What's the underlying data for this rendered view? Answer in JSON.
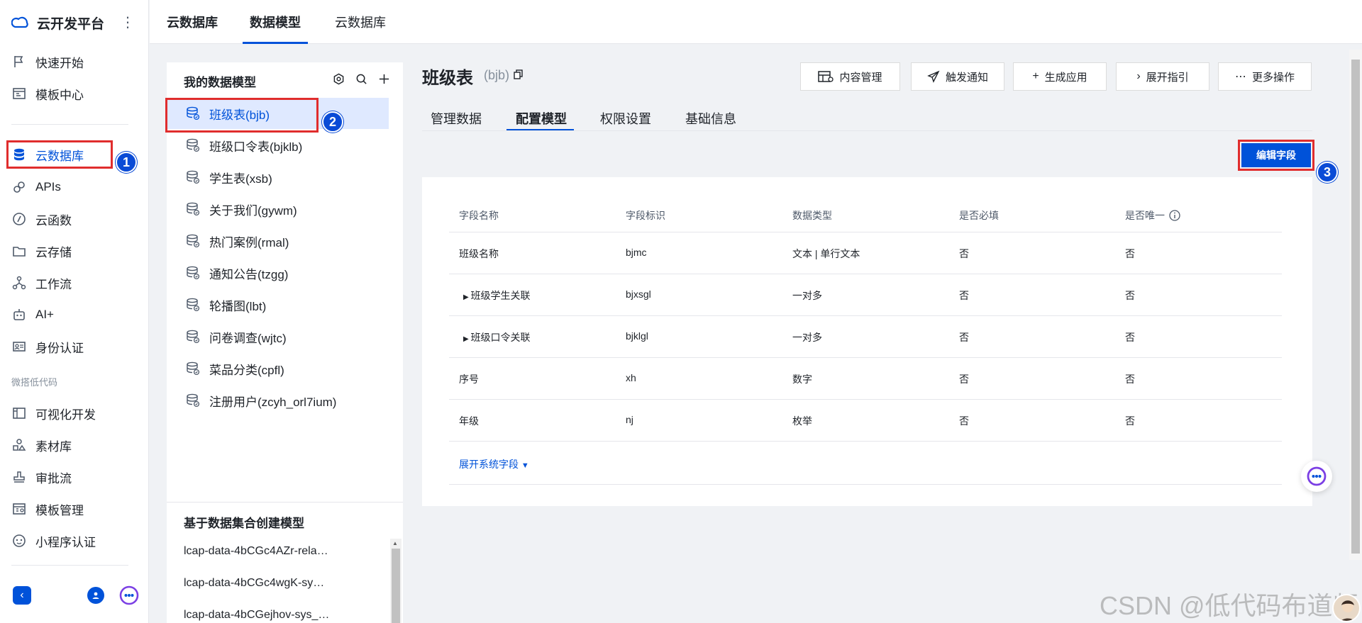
{
  "app": {
    "title": "云开发平台"
  },
  "sidebar": {
    "items": [
      {
        "label": "快速开始",
        "icon": "flag-icon"
      },
      {
        "label": "模板中心",
        "icon": "template-icon"
      },
      {
        "label": "云数据库",
        "icon": "database-icon",
        "active": true
      },
      {
        "label": "APIs",
        "icon": "link-icon"
      },
      {
        "label": "云函数",
        "icon": "function-icon"
      },
      {
        "label": "云存储",
        "icon": "folder-icon"
      },
      {
        "label": "工作流",
        "icon": "workflow-icon"
      },
      {
        "label": "AI+",
        "icon": "robot-icon"
      },
      {
        "label": "身份认证",
        "icon": "id-card-icon"
      }
    ],
    "section_label": "微搭低代码",
    "lowcode_items": [
      {
        "label": "可视化开发",
        "icon": "layout-icon"
      },
      {
        "label": "素材库",
        "icon": "shapes-icon"
      },
      {
        "label": "审批流",
        "icon": "stamp-icon"
      },
      {
        "label": "模板管理",
        "icon": "template-manage-icon"
      },
      {
        "label": "小程序认证",
        "icon": "miniprogram-icon"
      }
    ]
  },
  "topbar": {
    "tabs": [
      {
        "label": "云数据库"
      },
      {
        "label": "数据模型",
        "active": true
      },
      {
        "label": "云数据库"
      }
    ]
  },
  "model_panel": {
    "title": "我的数据模型",
    "models": [
      "班级表(bjb)",
      "班级口令表(bjklb)",
      "学生表(xsb)",
      "关于我们(gywm)",
      "热门案例(rmal)",
      "通知公告(tzgg)",
      "轮播图(lbt)",
      "问卷调查(wjtc)",
      "菜品分类(cpfl)",
      "注册用户(zcyh_orl7ium)"
    ],
    "selected_index": 0,
    "dataset_title": "基于数据集合创建模型",
    "datasets": [
      "lcap-data-4bCGc4AZr-rela…",
      "lcap-data-4bCGc4wgK-sy…",
      "lcap-data-4bCGejhov-sys_…"
    ]
  },
  "main": {
    "title": "班级表",
    "subtitle": "(bjb)",
    "actions": [
      {
        "label": "内容管理",
        "icon": "content-icon"
      },
      {
        "label": "触发通知",
        "icon": "send-icon"
      },
      {
        "label": "生成应用",
        "icon": "plus-icon"
      },
      {
        "label": "展开指引",
        "icon": "chevron-right-icon"
      },
      {
        "label": "更多操作",
        "icon": "more-icon"
      }
    ],
    "tabs": [
      {
        "label": "管理数据"
      },
      {
        "label": "配置模型",
        "active": true
      },
      {
        "label": "权限设置"
      },
      {
        "label": "基础信息"
      }
    ],
    "edit_button": "编辑字段",
    "table": {
      "headers": [
        "字段名称",
        "字段标识",
        "数据类型",
        "是否必填",
        "是否唯一"
      ],
      "rows": [
        {
          "name": "班级名称",
          "id": "bjmc",
          "type": "文本 | 单行文本",
          "required": "否",
          "unique": "否",
          "expandable": false
        },
        {
          "name": "班级学生关联",
          "id": "bjxsgl",
          "type": "一对多",
          "required": "否",
          "unique": "否",
          "expandable": true
        },
        {
          "name": "班级口令关联",
          "id": "bjklgl",
          "type": "一对多",
          "required": "否",
          "unique": "否",
          "expandable": true
        },
        {
          "name": "序号",
          "id": "xh",
          "type": "数字",
          "required": "否",
          "unique": "否",
          "expandable": false
        },
        {
          "name": "年级",
          "id": "nj",
          "type": "枚举",
          "required": "否",
          "unique": "否",
          "expandable": false
        }
      ]
    },
    "expand_system_fields": "展开系统字段"
  },
  "annotations": {
    "step1": "1",
    "step2": "2",
    "step3": "3"
  },
  "watermark": "CSDN @低代码布道师",
  "colors": {
    "accent": "#0052d9",
    "highlight_box": "#e02d2d",
    "step_badge": "#0a4bd6"
  }
}
